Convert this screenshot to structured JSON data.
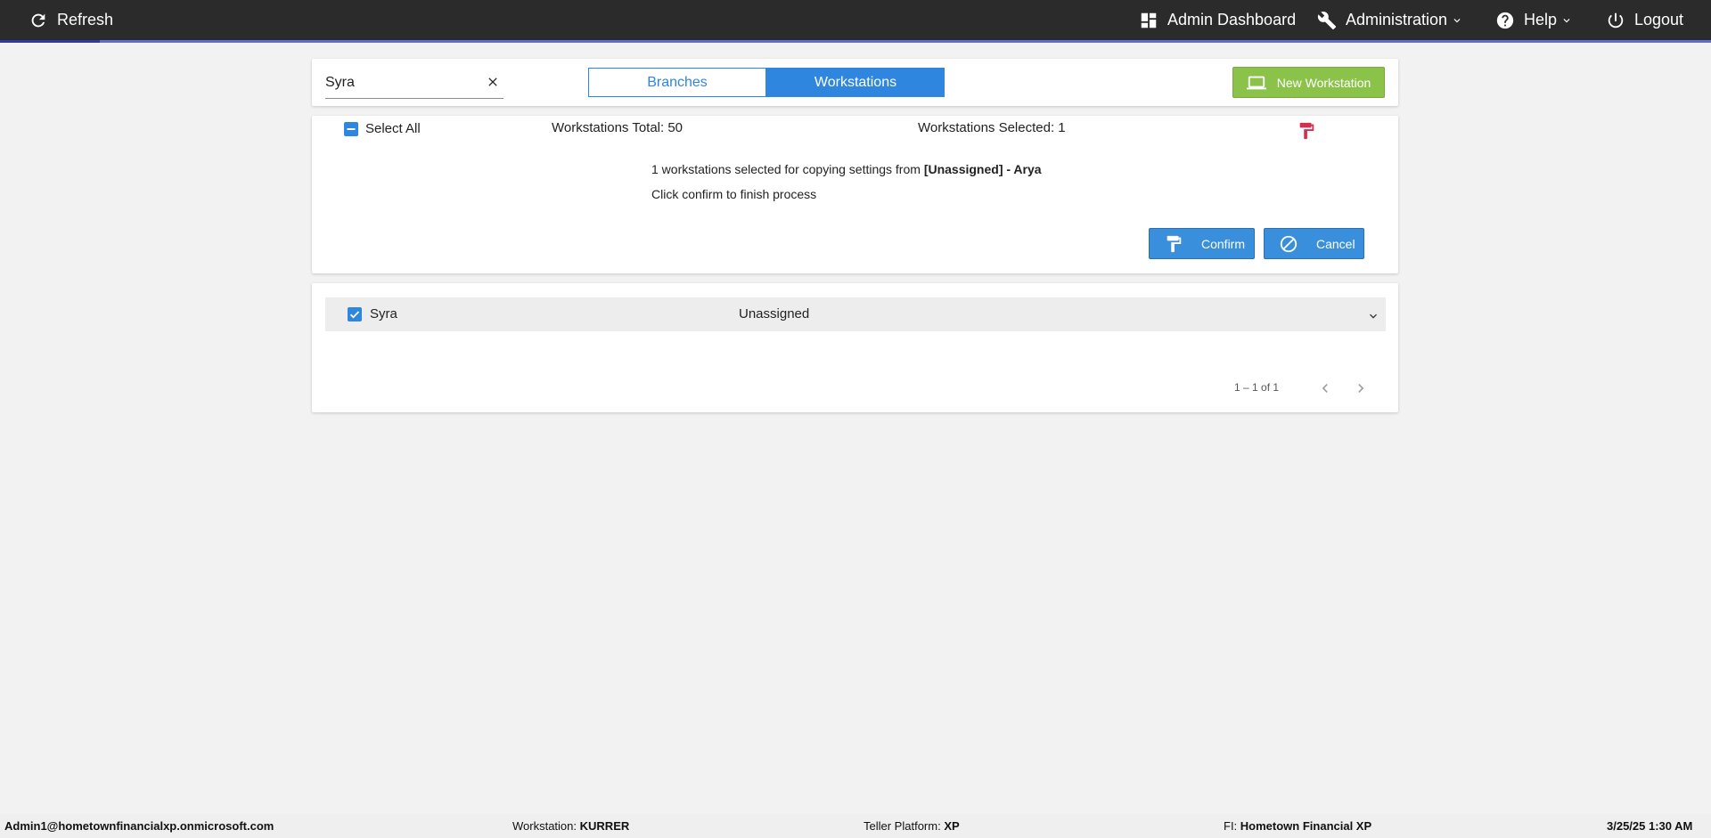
{
  "topbar": {
    "refresh_label": "Refresh",
    "admin_dashboard_label": "Admin Dashboard",
    "administration_label": "Administration",
    "help_label": "Help",
    "logout_label": "Logout"
  },
  "search": {
    "value": "Syra",
    "placeholder": ""
  },
  "toggle": {
    "branches_label": "Branches",
    "workstations_label": "Workstations",
    "active": "Workstations"
  },
  "new_workstation_label": "New Workstation",
  "selection": {
    "select_all_label": "Select All",
    "total_text": "Workstations Total: 50",
    "selected_text": "Workstations Selected: 1"
  },
  "copy_message": {
    "prefix": "1 workstations selected for copying settings from ",
    "source": "[Unassigned] - Arya",
    "line2": "Click confirm to finish process"
  },
  "confirm_label": "Confirm",
  "cancel_label": "Cancel",
  "workstations": [
    {
      "name": "Syra",
      "branch": "Unassigned",
      "checked": true
    }
  ],
  "pagination": {
    "range": "1 – 1 of 1"
  },
  "statusbar": {
    "user": "Admin1@hometownfinancialxp.onmicrosoft.com",
    "workstation_label": "Workstation:",
    "workstation_value": "KURRER",
    "platform_label": "Teller Platform:",
    "platform_value": "XP",
    "fi_label": "FI:",
    "fi_value": "Hometown Financial XP",
    "datetime": "3/25/25 1:30 AM"
  },
  "colors": {
    "topbar": "#2b2b2b",
    "accent_blue": "#2e86de",
    "green": "#8bc34a",
    "paint_icon": "#d32f4f"
  },
  "icons": {
    "refresh": "refresh-icon",
    "dashboard": "dashboard-icon",
    "wrench": "wrench-icon",
    "help": "help-circle-icon",
    "logout": "power-icon",
    "laptop": "laptop-icon",
    "paint_roller": "paint-roller-icon",
    "cancel": "block-icon"
  }
}
